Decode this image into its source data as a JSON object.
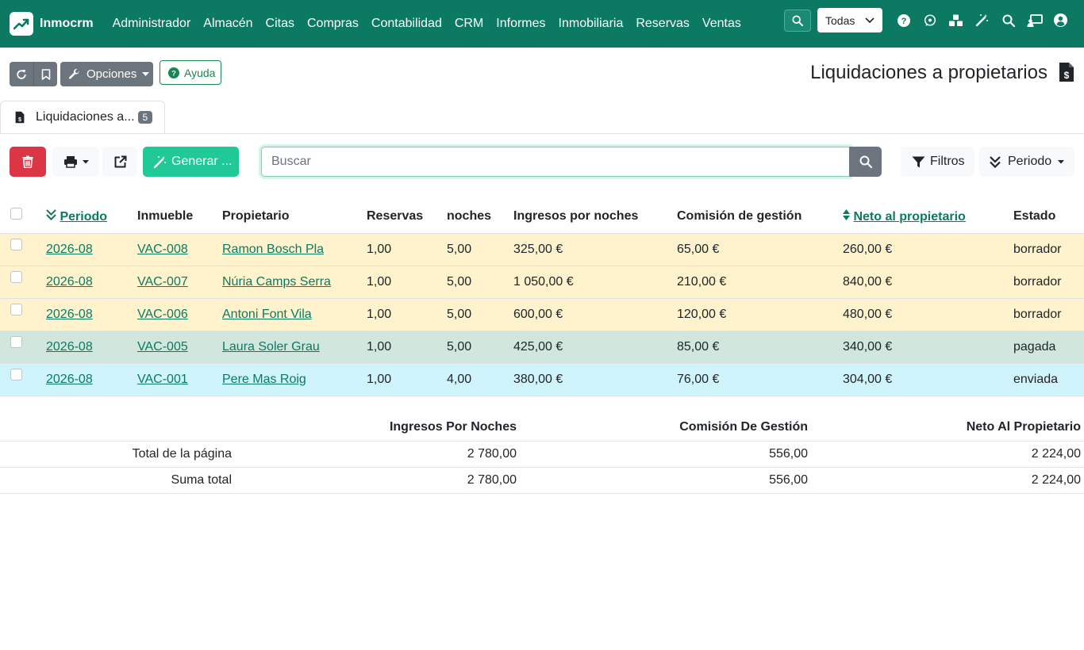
{
  "navbar": {
    "brand": "Inmocrm",
    "menu": [
      "Administrador",
      "Almacén",
      "Citas",
      "Compras",
      "Contabilidad",
      "CRM",
      "Informes",
      "Inmobiliaria",
      "Reservas",
      "Ventas"
    ],
    "company_select": "Todas",
    "icons": [
      "help-icon",
      "whatsapp-icon",
      "cubes-icon",
      "magic-wand-icon",
      "search-icon",
      "chalkboard-user-icon",
      "user-circle-icon"
    ]
  },
  "header": {
    "options_label": "Opciones",
    "help_label": "Ayuda",
    "title": "Liquidaciones a propietarios"
  },
  "tabs": [
    {
      "label": "Liquidaciones a...",
      "count": "5"
    }
  ],
  "toolbar": {
    "generate_label": "Generar ...",
    "search_placeholder": "Buscar",
    "filters_label": "Filtros",
    "period_label": "Periodo"
  },
  "table": {
    "columns": [
      "Periodo",
      "Inmueble",
      "Propietario",
      "Reservas",
      "noches",
      "Ingresos por noches",
      "Comisión de gestión",
      "Neto al propietario",
      "Estado"
    ],
    "rows": [
      {
        "periodo": "2026-08",
        "inmueble": "VAC-008",
        "propietario": "Ramon Bosch Pla",
        "reservas": "1,00",
        "noches": "5,00",
        "ingresos": "325,00 €",
        "comision": "65,00 €",
        "neto": "260,00 €",
        "estado": "borrador"
      },
      {
        "periodo": "2026-08",
        "inmueble": "VAC-007",
        "propietario": "Núria Camps Serra",
        "reservas": "1,00",
        "noches": "5,00",
        "ingresos": "1 050,00 €",
        "comision": "210,00 €",
        "neto": "840,00 €",
        "estado": "borrador"
      },
      {
        "periodo": "2026-08",
        "inmueble": "VAC-006",
        "propietario": "Antoni Font Vila",
        "reservas": "1,00",
        "noches": "5,00",
        "ingresos": "600,00 €",
        "comision": "120,00 €",
        "neto": "480,00 €",
        "estado": "borrador"
      },
      {
        "periodo": "2026-08",
        "inmueble": "VAC-005",
        "propietario": "Laura Soler Grau",
        "reservas": "1,00",
        "noches": "5,00",
        "ingresos": "425,00 €",
        "comision": "85,00 €",
        "neto": "340,00 €",
        "estado": "pagada"
      },
      {
        "periodo": "2026-08",
        "inmueble": "VAC-001",
        "propietario": "Pere Mas Roig",
        "reservas": "1,00",
        "noches": "4,00",
        "ingresos": "380,00 €",
        "comision": "76,00 €",
        "neto": "304,00 €",
        "estado": "enviada"
      }
    ]
  },
  "totals": {
    "headers": [
      "Ingresos Por Noches",
      "Comisión De Gestión",
      "Neto Al Propietario"
    ],
    "page_total": {
      "label": "Total de la página",
      "ingresos": "2 780,00",
      "comision": "556,00",
      "neto": "2 224,00"
    },
    "grand_total": {
      "label": "Suma total",
      "ingresos": "2 780,00",
      "comision": "556,00",
      "neto": "2 224,00"
    }
  },
  "colors": {
    "brand": "#0c7a63",
    "draft_row": "#fff3cd",
    "paid_row": "#d1e7dd",
    "sent_row": "#cff4fc",
    "danger": "#dc3545",
    "generate": "#20c997"
  }
}
